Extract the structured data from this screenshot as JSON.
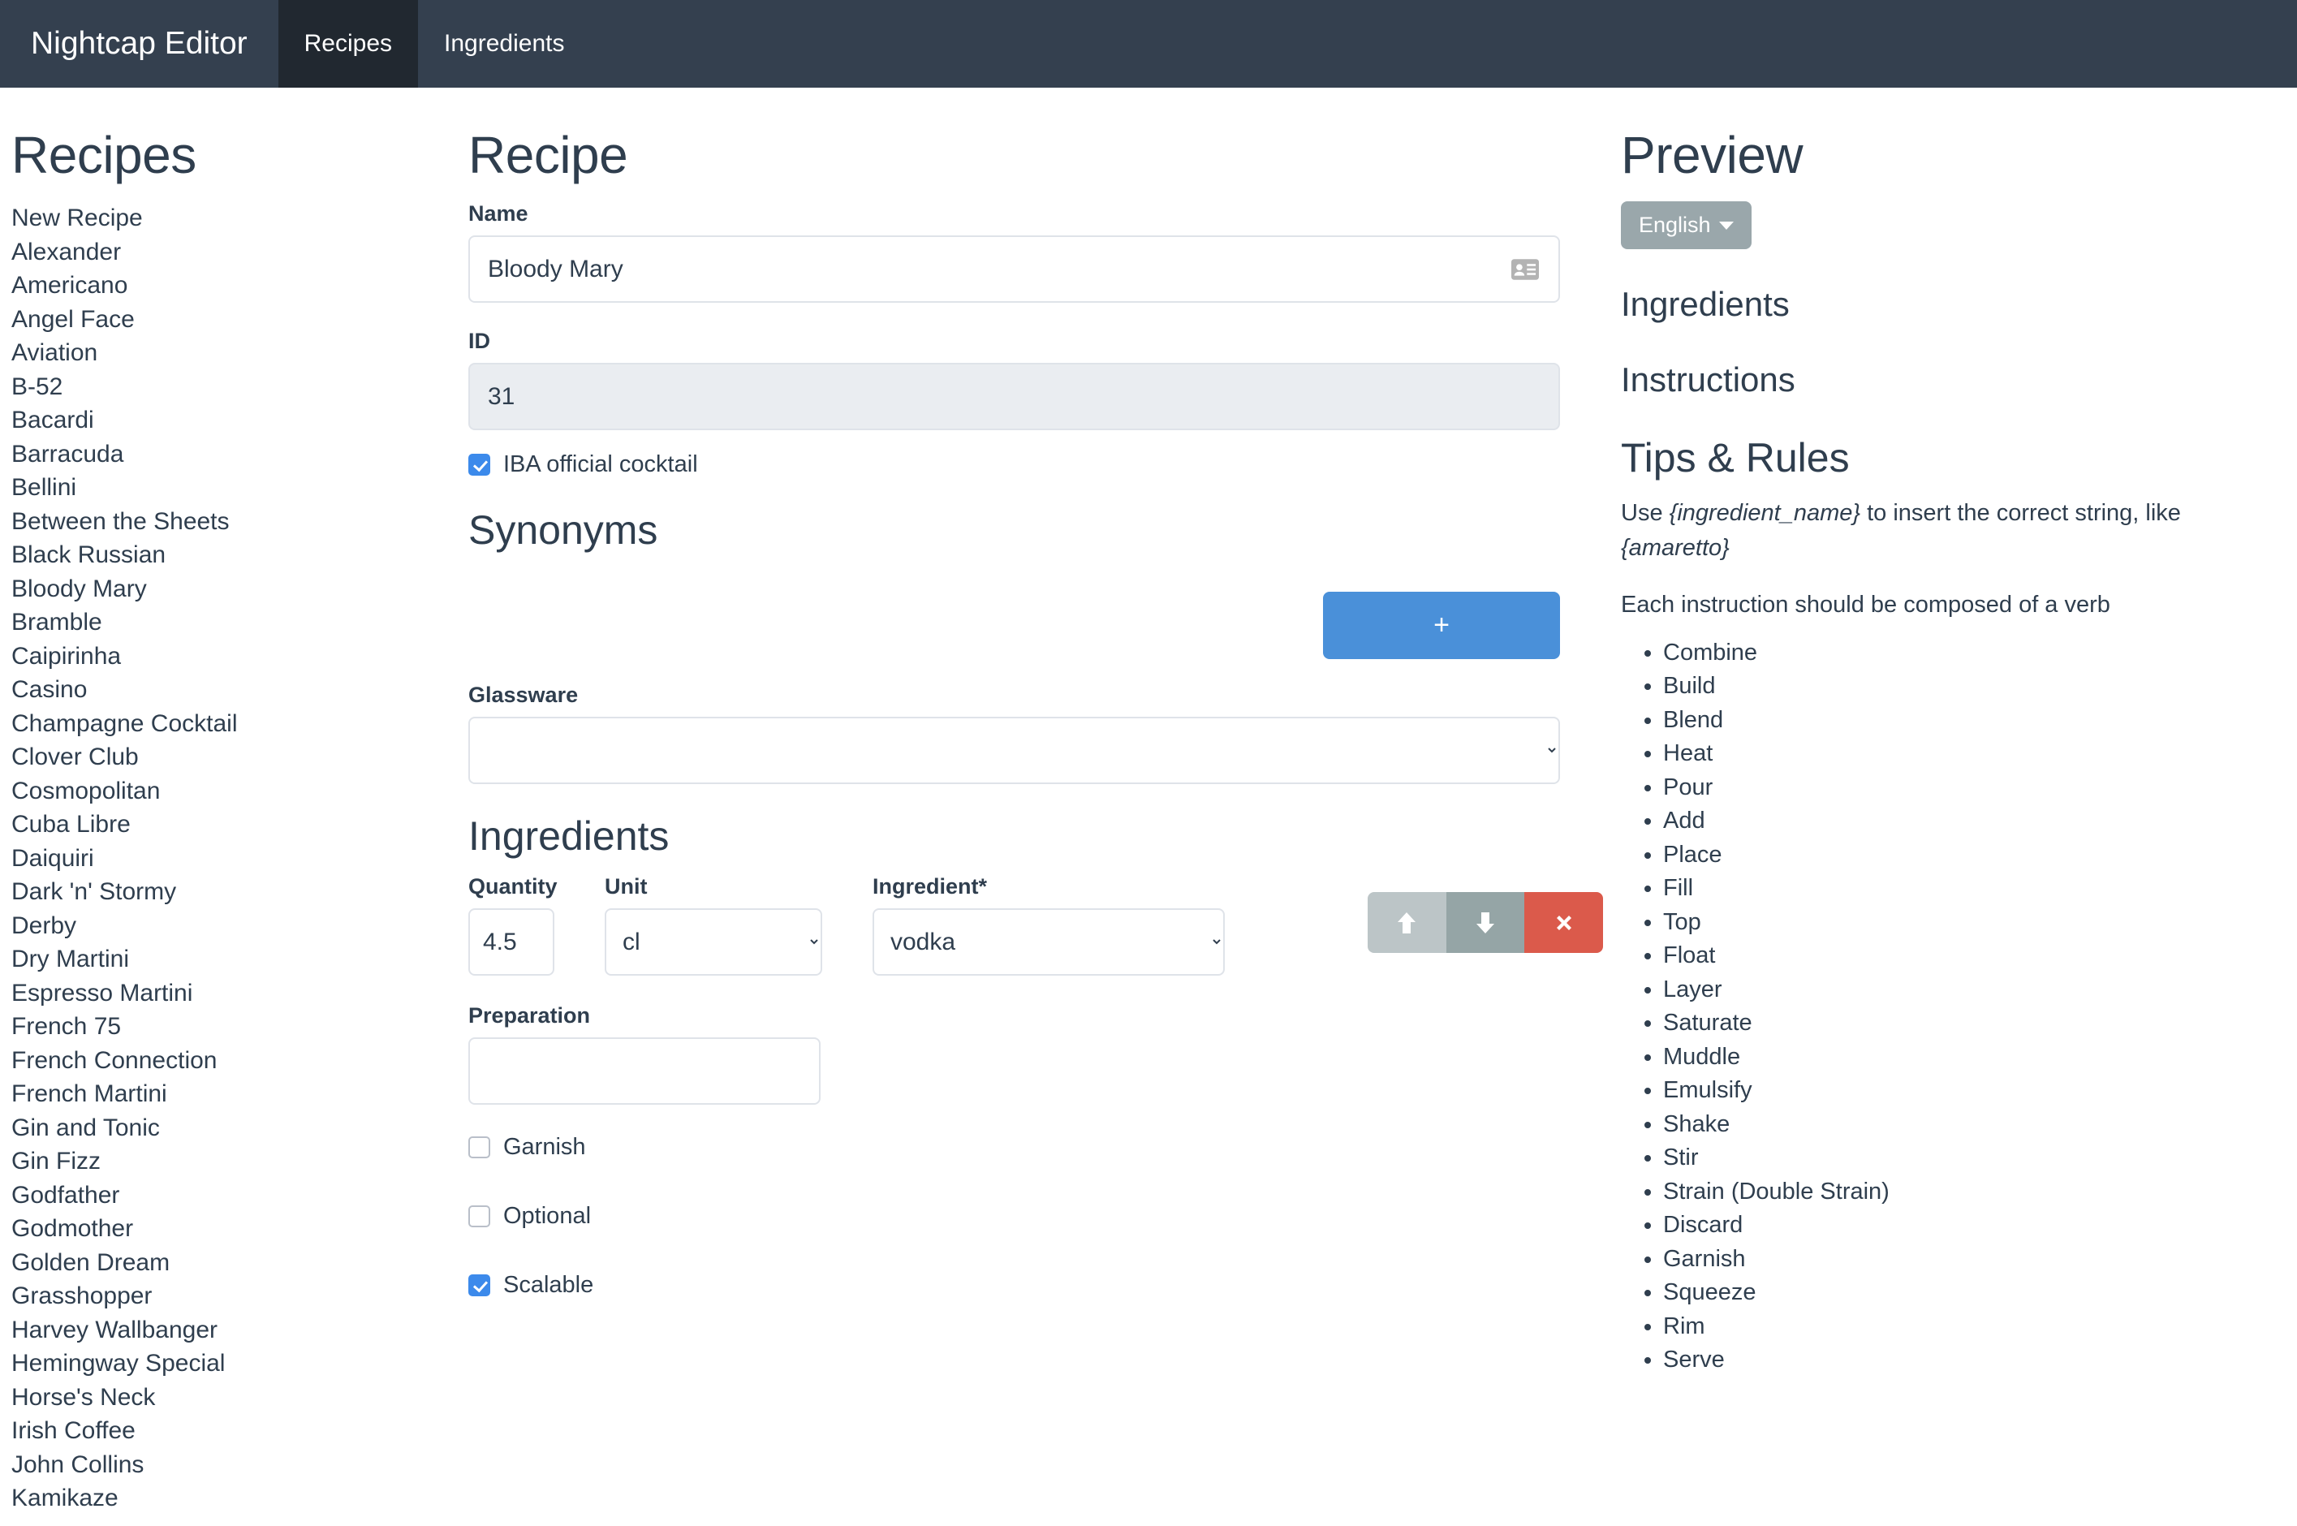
{
  "navbar": {
    "brand": "Nightcap Editor",
    "tabs": [
      {
        "label": "Recipes",
        "active": true
      },
      {
        "label": "Ingredients",
        "active": false
      }
    ]
  },
  "recipes_panel": {
    "title": "Recipes",
    "items": [
      "New Recipe",
      "Alexander",
      "Americano",
      "Angel Face",
      "Aviation",
      "B-52",
      "Bacardi",
      "Barracuda",
      "Bellini",
      "Between the Sheets",
      "Black Russian",
      "Bloody Mary",
      "Bramble",
      "Caipirinha",
      "Casino",
      "Champagne Cocktail",
      "Clover Club",
      "Cosmopolitan",
      "Cuba Libre",
      "Daiquiri",
      "Dark 'n' Stormy",
      "Derby",
      "Dry Martini",
      "Espresso Martini",
      "French 75",
      "French Connection",
      "French Martini",
      "Gin and Tonic",
      "Gin Fizz",
      "Godfather",
      "Godmother",
      "Golden Dream",
      "Grasshopper",
      "Harvey Wallbanger",
      "Hemingway Special",
      "Horse's Neck",
      "Irish Coffee",
      "John Collins",
      "Kamikaze"
    ]
  },
  "recipe_form": {
    "title": "Recipe",
    "name_label": "Name",
    "name_value": "Bloody Mary",
    "name_icon": "contact-card-icon",
    "id_label": "ID",
    "id_value": "31",
    "iba_label": "IBA official cocktail",
    "iba_checked": true,
    "synonyms_title": "Synonyms",
    "add_button_label": "+",
    "glassware_label": "Glassware",
    "glassware_value": "",
    "ingredients_title": "Ingredients",
    "col_quantity": "Quantity",
    "col_unit": "Unit",
    "col_ingredient": "Ingredient*",
    "quantity_value": "4.5",
    "unit_value": "cl",
    "ingredient_value": "vodka",
    "preparation_label": "Preparation",
    "preparation_value": "",
    "move_up_label": "⬆",
    "move_down_label": "⬇",
    "delete_label": "✖",
    "garnish_label": "Garnish",
    "garnish_checked": false,
    "optional_label": "Optional",
    "optional_checked": false,
    "scalable_label": "Scalable",
    "scalable_checked": true
  },
  "preview": {
    "title": "Preview",
    "language": "English",
    "ingredients_heading": "Ingredients",
    "instructions_heading": "Instructions",
    "tips_title": "Tips & Rules",
    "tip_line1_a": "Use ",
    "tip_line1_b": "{ingredient_name}",
    "tip_line1_c": " to insert the correct string, like ",
    "tip_line1_d": "{amaretto}",
    "tip_line2": "Each instruction should be composed of a verb",
    "verbs": [
      "Combine",
      "Build",
      "Blend",
      "Heat",
      "Pour",
      "Add",
      "Place",
      "Fill",
      "Top",
      "Float",
      "Layer",
      "Saturate",
      "Muddle",
      "Emulsify",
      "Shake",
      "Stir",
      "Strain (Double Strain)",
      "Discard",
      "Garnish",
      "Squeeze",
      "Rim",
      "Serve"
    ]
  },
  "colors": {
    "navbar": "#34404f",
    "navbar_active": "#212830",
    "accent_blue": "#4a90d9",
    "checkbox_blue": "#3c8aeb",
    "danger_red": "#db5a4b",
    "muted_gray": "#95a5a6",
    "light_gray": "#bcc5c7",
    "text": "#2f3e4e"
  }
}
